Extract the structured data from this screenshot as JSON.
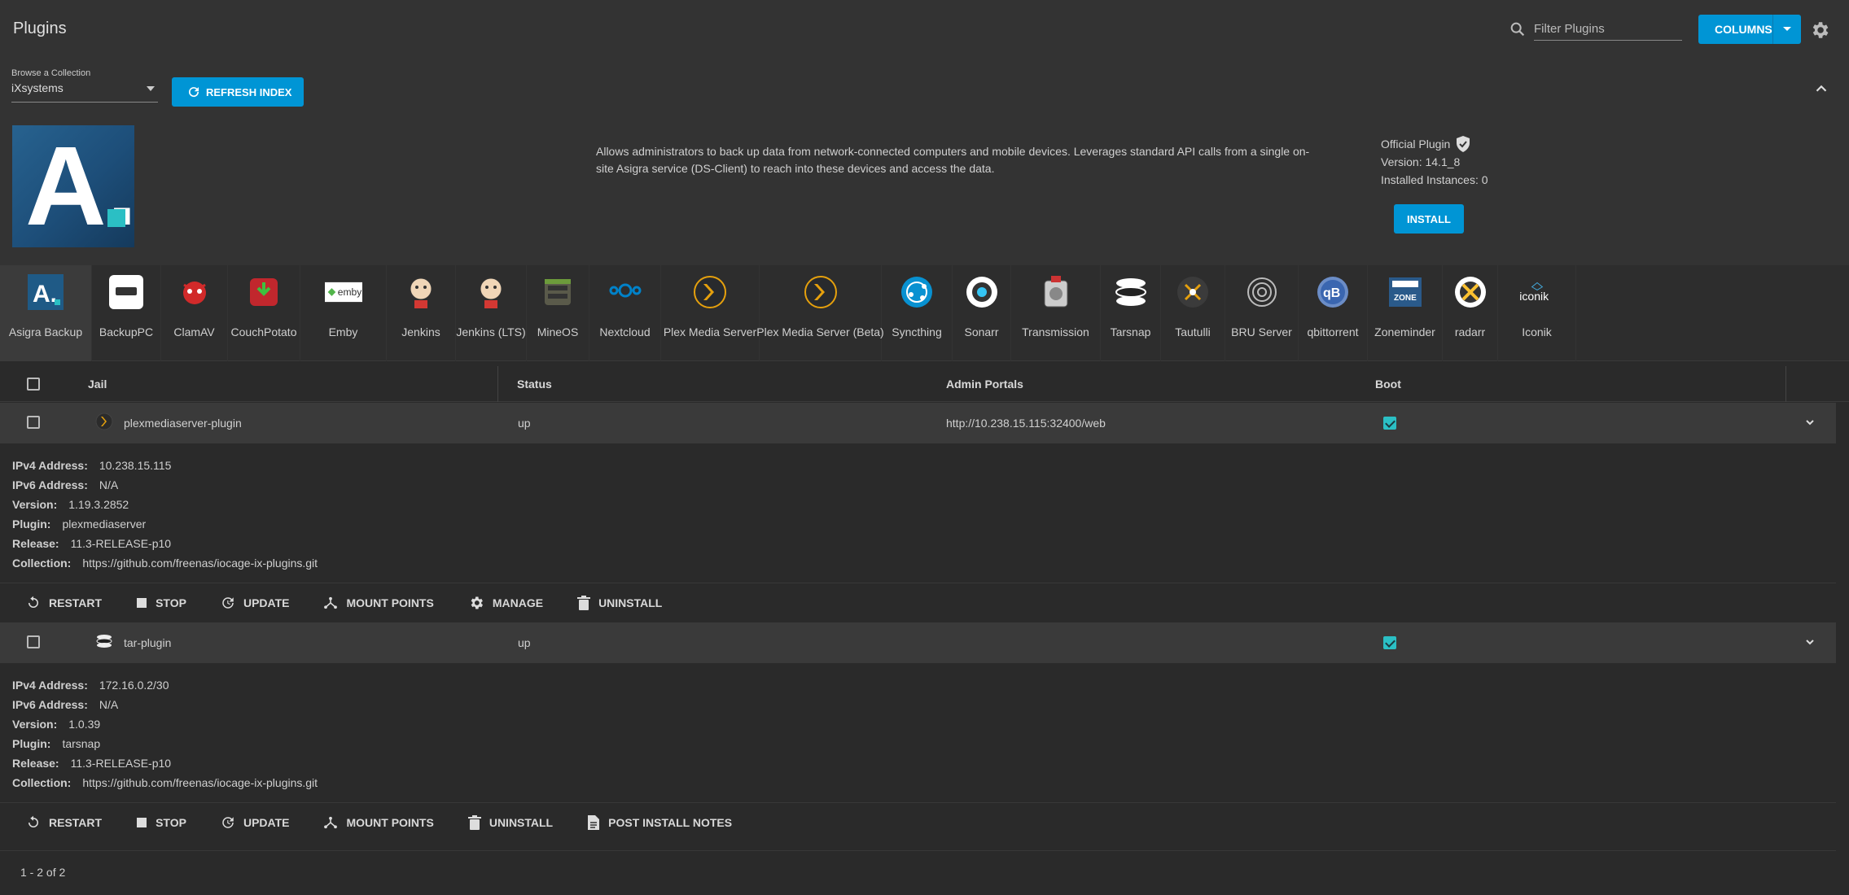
{
  "header": {
    "title": "Plugins",
    "filter_placeholder": "Filter Plugins",
    "columns_label": "COLUMNS"
  },
  "browse": {
    "collection_label": "Browse a Collection",
    "collection_value": "iXsystems",
    "refresh_label": "REFRESH INDEX"
  },
  "selected_plugin": {
    "logo_letter": "A.",
    "description": "Allows administrators to back up data from network-connected computers and mobile devices. Leverages standard API calls from a single on-site Asigra service (DS-Client) to reach into these devices and access the data.",
    "official_label": "Official Plugin",
    "version": "Version: 14.1_8",
    "installed": "Installed Instances: 0",
    "install_label": "INSTALL"
  },
  "plugins": [
    {
      "name": "Asigra Backup",
      "icon": "asigra-icon",
      "selected": true
    },
    {
      "name": "BackupPC",
      "icon": "backuppc-icon"
    },
    {
      "name": "ClamAV",
      "icon": "clamav-icon"
    },
    {
      "name": "CouchPotato",
      "icon": "couchpotato-icon"
    },
    {
      "name": "Emby",
      "icon": "emby-icon"
    },
    {
      "name": "Jenkins",
      "icon": "jenkins-icon"
    },
    {
      "name": "Jenkins (LTS)",
      "icon": "jenkins-lts-icon"
    },
    {
      "name": "MineOS",
      "icon": "mineos-icon"
    },
    {
      "name": "Nextcloud",
      "icon": "nextcloud-icon"
    },
    {
      "name": "Plex Media Server",
      "icon": "plex-icon"
    },
    {
      "name": "Plex Media Server (Beta)",
      "icon": "plex-beta-icon"
    },
    {
      "name": "Syncthing",
      "icon": "syncthing-icon"
    },
    {
      "name": "Sonarr",
      "icon": "sonarr-icon"
    },
    {
      "name": "Transmission",
      "icon": "transmission-icon"
    },
    {
      "name": "Tarsnap",
      "icon": "tarsnap-icon"
    },
    {
      "name": "Tautulli",
      "icon": "tautulli-icon"
    },
    {
      "name": "BRU Server",
      "icon": "bru-server-icon"
    },
    {
      "name": "qbittorrent",
      "icon": "qbittorrent-icon"
    },
    {
      "name": "Zoneminder",
      "icon": "zoneminder-icon"
    },
    {
      "name": "radarr",
      "icon": "radarr-icon"
    },
    {
      "name": "Iconik",
      "icon": "iconik-icon"
    }
  ],
  "table": {
    "headers": {
      "jail": "Jail",
      "status": "Status",
      "admin": "Admin Portals",
      "boot": "Boot"
    },
    "rows": [
      {
        "jail": "plexmediaserver-plugin",
        "status": "up",
        "admin": "http://10.238.15.115:32400/web",
        "boot": true,
        "details": [
          {
            "k": "IPv4 Address:",
            "v": "10.238.15.115"
          },
          {
            "k": "IPv6 Address:",
            "v": "N/A"
          },
          {
            "k": "Version:",
            "v": "1.19.3.2852"
          },
          {
            "k": "Plugin:",
            "v": "plexmediaserver"
          },
          {
            "k": "Release:",
            "v": "11.3-RELEASE-p10"
          },
          {
            "k": "Collection:",
            "v": "https://github.com/freenas/iocage-ix-plugins.git"
          }
        ],
        "actions": [
          "RESTART",
          "STOP",
          "UPDATE",
          "MOUNT POINTS",
          "MANAGE",
          "UNINSTALL"
        ]
      },
      {
        "jail": "tar-plugin",
        "status": "up",
        "admin": "",
        "boot": true,
        "details": [
          {
            "k": "IPv4 Address:",
            "v": "172.16.0.2/30"
          },
          {
            "k": "IPv6 Address:",
            "v": "N/A"
          },
          {
            "k": "Version:",
            "v": "1.0.39"
          },
          {
            "k": "Plugin:",
            "v": "tarsnap"
          },
          {
            "k": "Release:",
            "v": "11.3-RELEASE-p10"
          },
          {
            "k": "Collection:",
            "v": "https://github.com/freenas/iocage-ix-plugins.git"
          }
        ],
        "actions": [
          "RESTART",
          "STOP",
          "UPDATE",
          "MOUNT POINTS",
          "UNINSTALL",
          "POST INSTALL NOTES"
        ]
      }
    ]
  },
  "footer": {
    "range": "1 - 2 of 2"
  },
  "colors": {
    "accent": "#0095d5",
    "teal": "#2bbfc4",
    "bg": "#2a2a2a",
    "panel": "#333333"
  }
}
